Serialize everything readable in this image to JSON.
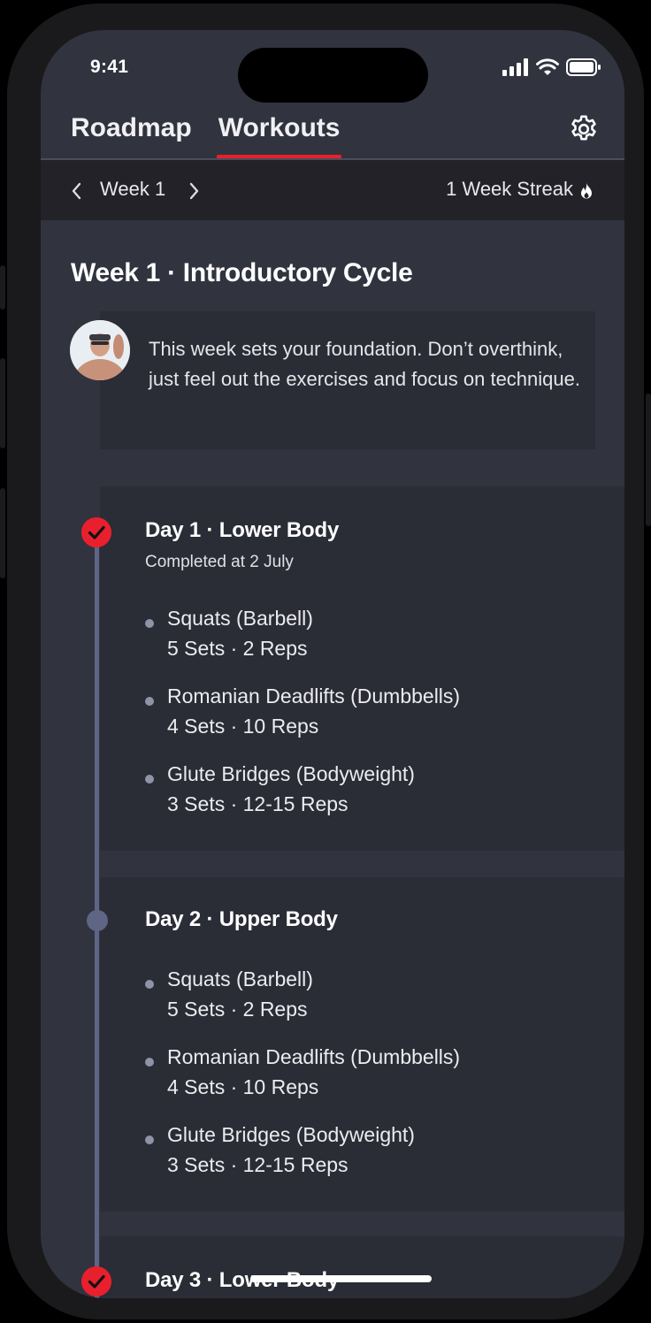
{
  "status_bar": {
    "time": "9:41"
  },
  "header": {
    "tabs": [
      {
        "label": "Roadmap",
        "active": false
      },
      {
        "label": "Workouts",
        "active": true
      }
    ],
    "settings_icon": "gear-icon",
    "accent_color": "#e8202d"
  },
  "week_bar": {
    "week_label": "Week 1",
    "streak_label": "1 Week Streak",
    "streak_icon": "flame-icon"
  },
  "main": {
    "title": "Week 1 · Introductory Cycle",
    "coach_message": "This week sets your foundation. Don’t overthink, just feel out the exercises and focus on technique.",
    "days": [
      {
        "title": "Day 1 · Lower Body",
        "status": "completed",
        "subtitle": "Completed at 2 July",
        "exercises": [
          {
            "name": "Squats (Barbell)",
            "detail": "5 Sets · 2 Reps"
          },
          {
            "name": "Romanian Deadlifts (Dumbbells)",
            "detail": "4 Sets · 10 Reps"
          },
          {
            "name": "Glute Bridges (Bodyweight)",
            "detail": "3 Sets · 12-15 Reps"
          }
        ]
      },
      {
        "title": "Day 2 · Upper Body",
        "status": "pending",
        "exercises": [
          {
            "name": "Squats (Barbell)",
            "detail": "5 Sets · 2 Reps"
          },
          {
            "name": "Romanian Deadlifts (Dumbbells)",
            "detail": "4 Sets · 10 Reps"
          },
          {
            "name": "Glute Bridges (Bodyweight)",
            "detail": "3 Sets · 12-15 Reps"
          }
        ]
      },
      {
        "title": "Day 3 · Lower Body",
        "status": "completed"
      }
    ]
  }
}
